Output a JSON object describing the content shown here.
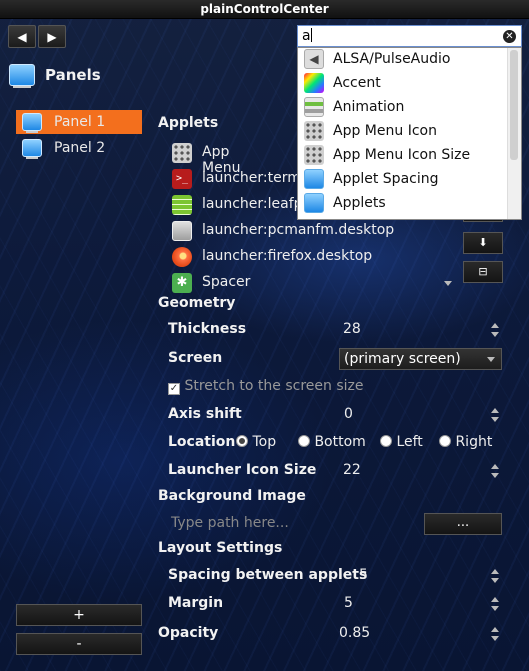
{
  "window": {
    "title": "plainControlCenter"
  },
  "nav": {
    "back": "◀",
    "forward": "▶"
  },
  "section": {
    "title": "Panels"
  },
  "sidebar": {
    "items": [
      {
        "label": "Panel 1"
      },
      {
        "label": "Panel 2"
      }
    ],
    "add_label": "+",
    "remove_label": "-"
  },
  "applets": {
    "heading": "Applets",
    "items": [
      {
        "label": "App Menu",
        "icon": "grid-icon"
      },
      {
        "label": "launcher:terminal.desktop",
        "icon": "terminal-icon"
      },
      {
        "label": "launcher:leafpad.desktop",
        "icon": "leafpad-icon"
      },
      {
        "label": "launcher:pcmanfm.desktop",
        "icon": "folder-icon"
      },
      {
        "label": "launcher:firefox.desktop",
        "icon": "firefox-icon"
      },
      {
        "label": "Spacer",
        "icon": "puzzle-icon"
      }
    ],
    "move_down_label": "⬇",
    "remove_label": "⊟"
  },
  "geometry": {
    "heading": "Geometry",
    "thickness": {
      "label": "Thickness",
      "value": "28"
    },
    "screen": {
      "label": "Screen",
      "value": "(primary screen)"
    },
    "stretch": {
      "label": "Stretch to the screen size",
      "checked": true
    },
    "axis_shift": {
      "label": "Axis shift",
      "value": "0"
    },
    "location": {
      "label": "Location",
      "options": [
        "Top",
        "Bottom",
        "Left",
        "Right"
      ],
      "selected": "Top"
    },
    "launcher_icon_size": {
      "label": "Launcher Icon Size",
      "value": "22"
    }
  },
  "background": {
    "heading": "Background Image",
    "placeholder": "Type path here...",
    "browse_label": "..."
  },
  "layout": {
    "heading": "Layout Settings",
    "spacing": {
      "label": "Spacing between applets",
      "value": "5"
    },
    "margin": {
      "label": "Margin",
      "value": "5"
    }
  },
  "opacity": {
    "label": "Opacity",
    "value": "0.85"
  },
  "search": {
    "value": "a",
    "results": [
      {
        "label": "ALSA/PulseAudio",
        "icon": "speaker-icon"
      },
      {
        "label": "Accent",
        "icon": "color-palette-icon"
      },
      {
        "label": "Animation",
        "icon": "toggle-icon"
      },
      {
        "label": "App Menu Icon",
        "icon": "grid-icon"
      },
      {
        "label": "App Menu Icon Size",
        "icon": "grid-icon"
      },
      {
        "label": "Applet Spacing",
        "icon": "monitor-icon"
      },
      {
        "label": "Applets",
        "icon": "monitor-icon"
      }
    ]
  },
  "colors": {
    "selection": "#f36f1d",
    "background": "#0d1a3b"
  }
}
